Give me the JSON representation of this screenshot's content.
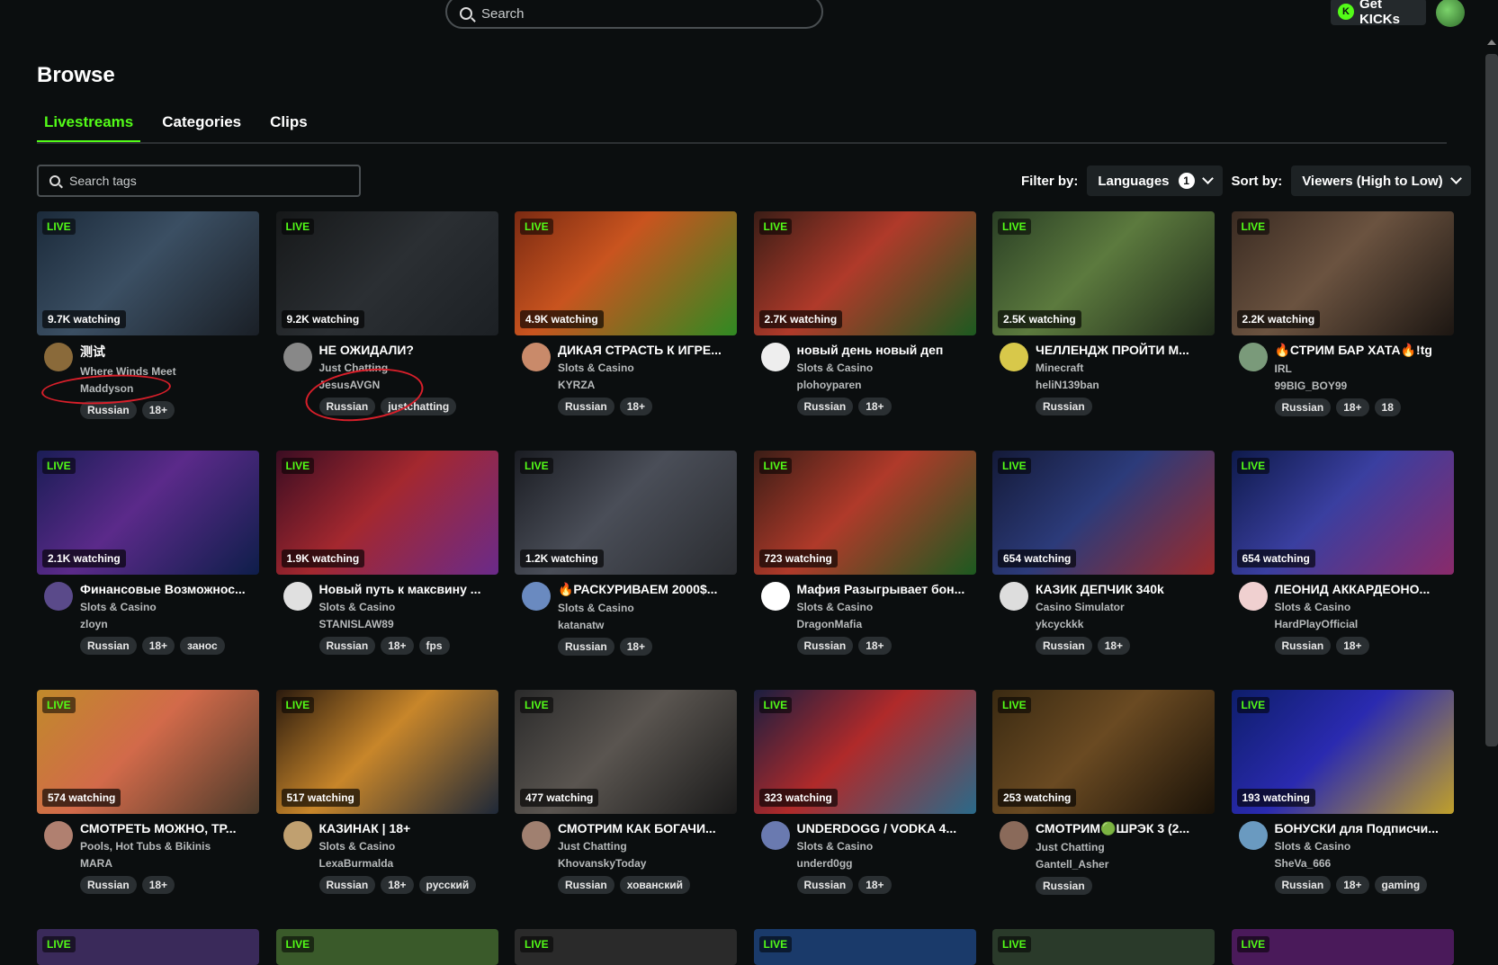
{
  "topbar": {
    "search_placeholder": "Search",
    "get_kicks": "Get KICKs"
  },
  "page": {
    "title": "Browse"
  },
  "tabs": [
    {
      "label": "Livestreams"
    },
    {
      "label": "Categories"
    },
    {
      "label": "Clips"
    }
  ],
  "tags_search": {
    "placeholder": "Search tags"
  },
  "filters": {
    "filter_label": "Filter by:",
    "languages": "Languages",
    "languages_count": "1",
    "sort_label": "Sort by:",
    "sort_value": "Viewers (High to Low)"
  },
  "live_label": "LIVE",
  "streams": [
    {
      "watching": "9.7K watching",
      "title": "测试",
      "category": "Where Winds Meet",
      "channel": "Maddyson",
      "tags": [
        "Russian",
        "18+"
      ]
    },
    {
      "watching": "9.2K watching",
      "title": "НЕ ОЖИДАЛИ?",
      "category": "Just Chatting",
      "channel": "JesusAVGN",
      "tags": [
        "Russian",
        "justchatting"
      ]
    },
    {
      "watching": "4.9K watching",
      "title": "ДИКАЯ СТРАСТЬ К ИГРЕ...",
      "category": "Slots & Casino",
      "channel": "KYRZA",
      "tags": [
        "Russian",
        "18+"
      ]
    },
    {
      "watching": "2.7K watching",
      "title": "новый день новый деп",
      "category": "Slots & Casino",
      "channel": "plohoyparen",
      "tags": [
        "Russian",
        "18+"
      ]
    },
    {
      "watching": "2.5K watching",
      "title": "ЧЕЛЛЕНДЖ ПРОЙТИ М...",
      "category": "Minecraft",
      "channel": "heliN139ban",
      "tags": [
        "Russian"
      ]
    },
    {
      "watching": "2.2K watching",
      "title": "🔥СТРИМ БАР ХАТА🔥!tg",
      "category": "IRL",
      "channel": "99BIG_BOY99",
      "tags": [
        "Russian",
        "18+",
        "18"
      ]
    },
    {
      "watching": "2.1K watching",
      "title": "Финансовые Возможнос...",
      "category": "Slots & Casino",
      "channel": "zloyn",
      "tags": [
        "Russian",
        "18+",
        "занос"
      ]
    },
    {
      "watching": "1.9K watching",
      "title": "Новый путь к максвину ...",
      "category": "Slots & Casino",
      "channel": "STANISLAW89",
      "tags": [
        "Russian",
        "18+",
        "fps"
      ]
    },
    {
      "watching": "1.2K watching",
      "title": "🔥РАСКУРИВАЕМ 2000$...",
      "category": "Slots & Casino",
      "channel": "katanatw",
      "tags": [
        "Russian",
        "18+"
      ]
    },
    {
      "watching": "723 watching",
      "title": "Мафия Разыгрывает бон...",
      "category": "Slots & Casino",
      "channel": "DragonMafia",
      "tags": [
        "Russian",
        "18+"
      ]
    },
    {
      "watching": "654 watching",
      "title": "КАЗИК ДЕПЧИК 340k",
      "category": "Casino Simulator",
      "channel": "ykcyckkk",
      "tags": [
        "Russian",
        "18+"
      ]
    },
    {
      "watching": "654 watching",
      "title": "ЛЕОНИД АККАРДЕОНО...",
      "category": "Slots & Casino",
      "channel": "HardPlayOfficial",
      "tags": [
        "Russian",
        "18+"
      ]
    },
    {
      "watching": "574 watching",
      "title": "СМОТРЕТЬ МОЖНО, ТР...",
      "category": "Pools, Hot Tubs & Bikinis",
      "channel": "MARA",
      "tags": [
        "Russian",
        "18+"
      ]
    },
    {
      "watching": "517 watching",
      "title": "КАЗИНАК | 18+",
      "category": "Slots & Casino",
      "channel": "LexaBurmalda",
      "tags": [
        "Russian",
        "18+",
        "русский"
      ]
    },
    {
      "watching": "477 watching",
      "title": "СМОТРИМ КАК БОГАЧИ...",
      "category": "Just Chatting",
      "channel": "KhovanskyToday",
      "tags": [
        "Russian",
        "хованский"
      ]
    },
    {
      "watching": "323 watching",
      "title": "UNDERDOGG / VODKA 4...",
      "category": "Slots & Casino",
      "channel": "underd0gg",
      "tags": [
        "Russian",
        "18+"
      ]
    },
    {
      "watching": "253 watching",
      "title": "СМОТРИМ🟢ШРЭК 3 (2...",
      "category": "Just Chatting",
      "channel": "Gantell_Asher",
      "tags": [
        "Russian"
      ]
    },
    {
      "watching": "193 watching",
      "title": "БОНУСКИ для Подписчи...",
      "category": "Slots & Casino",
      "channel": "SheVa_666",
      "tags": [
        "Russian",
        "18+",
        "gaming"
      ]
    }
  ],
  "colors": {
    "accent": "#53fc18",
    "background": "#0b0e0f",
    "annotation": "#d81f2a"
  }
}
